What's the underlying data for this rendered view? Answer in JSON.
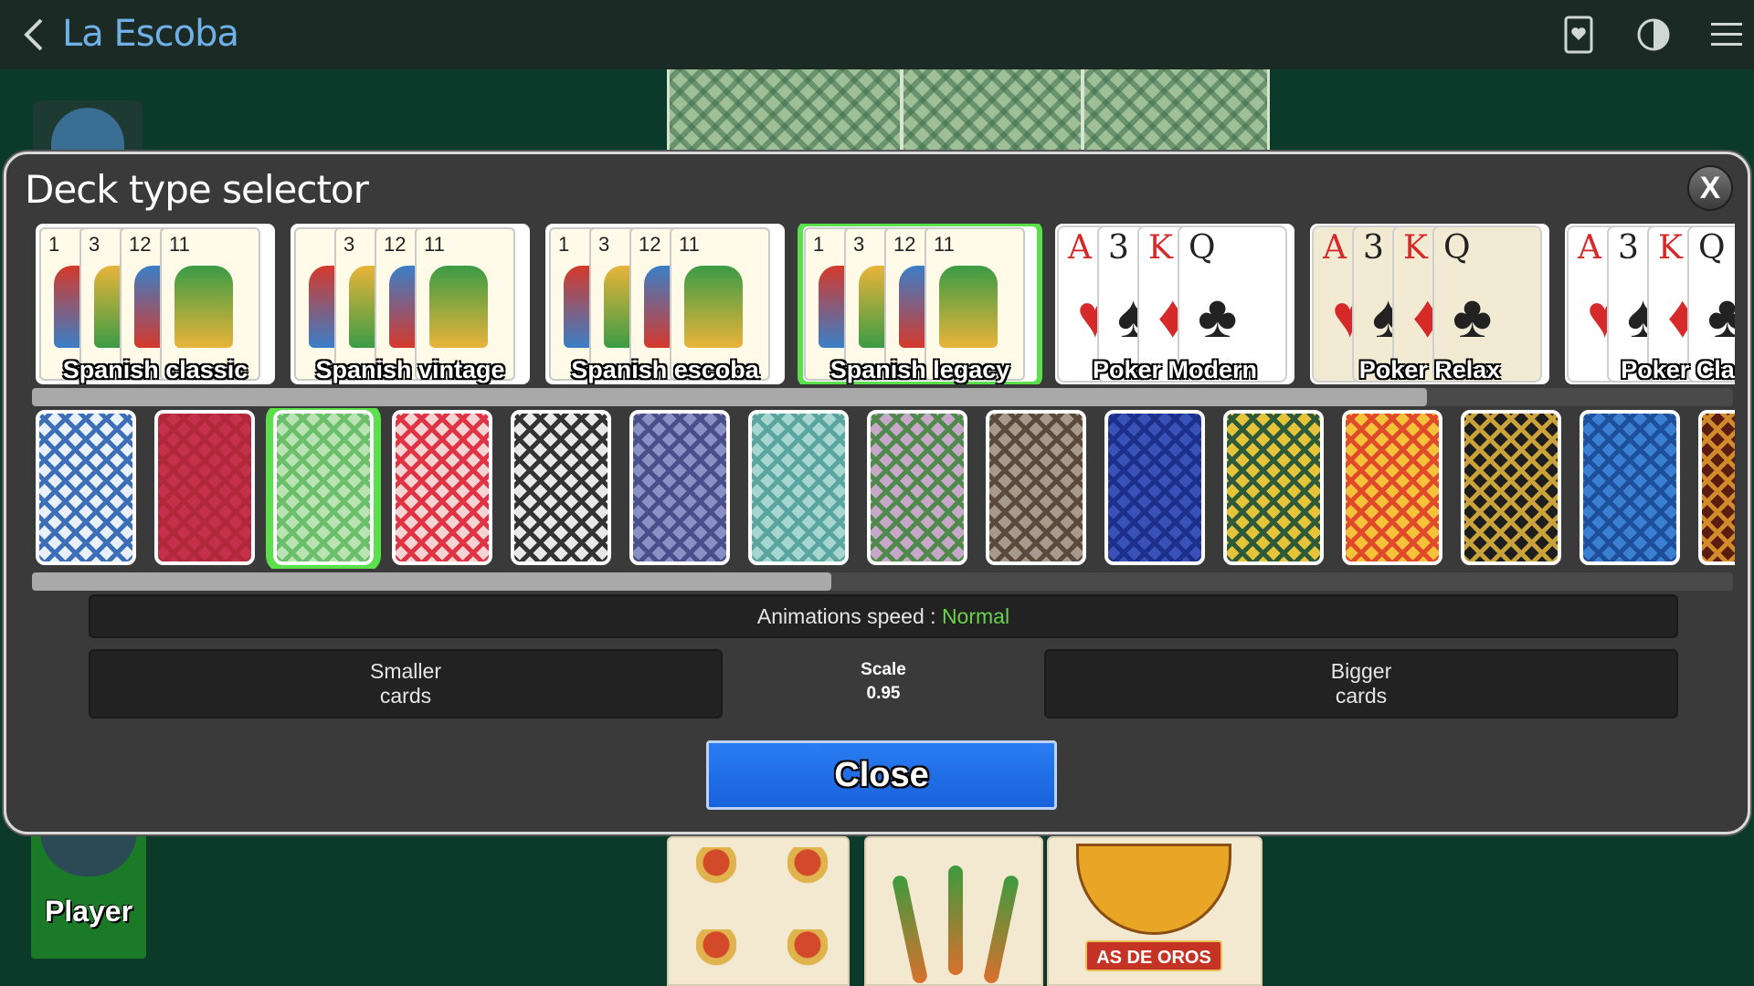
{
  "header": {
    "title": "La Escoba",
    "icons": [
      "chevron-left-icon",
      "card-heart-icon",
      "contrast-icon",
      "hamburger-menu-icon"
    ]
  },
  "table": {
    "player_name": "Player",
    "oros_card_text": "AS DE OROS"
  },
  "dialog": {
    "title": "Deck type selector",
    "close_x": "X",
    "decks": [
      {
        "label": "Spanish classic",
        "style": "spanish",
        "ranks": [
          "1",
          "3",
          "12",
          "11"
        ]
      },
      {
        "label": "Spanish vintage",
        "style": "spanish",
        "ranks": [
          "",
          "3",
          "12",
          "11"
        ]
      },
      {
        "label": "Spanish escoba",
        "style": "spanish",
        "ranks": [
          "1",
          "3",
          "12",
          "11"
        ]
      },
      {
        "label": "Spanish legacy",
        "style": "spanish",
        "ranks": [
          "1",
          "3",
          "12",
          "11"
        ],
        "selected": true
      },
      {
        "label": "Poker Modern",
        "style": "poker",
        "ranks": [
          "A",
          "3",
          "K",
          "Q"
        ]
      },
      {
        "label": "Poker Relax",
        "style": "poker",
        "ranks": [
          "A",
          "3",
          "K",
          "Q"
        ]
      },
      {
        "label": "Poker Clas",
        "style": "poker",
        "ranks": [
          "A",
          "3",
          "K",
          "Q"
        ]
      }
    ],
    "card_backs": [
      {
        "name": "blue-ornament",
        "color": "#3d6fb8",
        "bg": "#e8f0fb"
      },
      {
        "name": "red-ornament",
        "color": "#b0283a",
        "bg": "#c5304a"
      },
      {
        "name": "green-plaid",
        "color": "#6cbf6a",
        "bg": "#b9e3b2",
        "selected": true
      },
      {
        "name": "red-lattice",
        "color": "#e03444",
        "bg": "#f6d4d4"
      },
      {
        "name": "black-lattice",
        "color": "#333333",
        "bg": "#e8e8e8"
      },
      {
        "name": "purple-floral",
        "color": "#4a4f8c",
        "bg": "#8a8fc4"
      },
      {
        "name": "teal-floral",
        "color": "#5aa59f",
        "bg": "#a6d6cf"
      },
      {
        "name": "green-floral",
        "color": "#4f8a4c",
        "bg": "#c7a8c9"
      },
      {
        "name": "sepia-ornament",
        "color": "#5a4a3e",
        "bg": "#a89a8a"
      },
      {
        "name": "blue-classic",
        "color": "#1c2f8a",
        "bg": "#3a52b8"
      },
      {
        "name": "yellow-mandala",
        "color": "#2f5a3a",
        "bg": "#e6c43a"
      },
      {
        "name": "orange-party",
        "color": "#e04a2a",
        "bg": "#f6c23a"
      },
      {
        "name": "black-gold",
        "color": "#c9a23a",
        "bg": "#1e1e1e"
      },
      {
        "name": "blue-diamond",
        "color": "#1d4f9a",
        "bg": "#3a7fd2"
      },
      {
        "name": "dark-red",
        "color": "#d28a2a",
        "bg": "#5a1e10"
      }
    ],
    "animations_label": "Animations speed :",
    "animations_value": "Normal",
    "smaller_line1": "Smaller",
    "smaller_line2": "cards",
    "scale_label": "Scale",
    "scale_value": "0.95",
    "bigger_line1": "Bigger",
    "bigger_line2": "cards",
    "close_label": "Close",
    "deck_scroll_fraction": 0.82,
    "back_scroll_fraction": 0.47
  },
  "colors": {
    "accent_green": "#5ae04a",
    "value_green": "#69d34a",
    "button_blue": "#2a7cf2",
    "title_blue": "#6fb0e6"
  }
}
